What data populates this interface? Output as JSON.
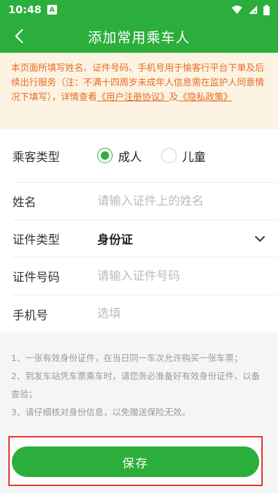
{
  "status_bar": {
    "time": "10:48",
    "notif_glyph": "A"
  },
  "header": {
    "title": "添加常用乘车人"
  },
  "notice": {
    "text": "本页面所填写姓名、证件号码、手机号用于愉客行平台下单及后续出行服务（注：不满十四周岁未成年人信息需在监护人同意情况下填写），详情查看",
    "link1": "《用户注册协议》",
    "between": "及",
    "link2": "《隐私政策》"
  },
  "form": {
    "passenger_type": {
      "label": "乘客类型",
      "options": [
        "成人",
        "儿童"
      ],
      "selected": "成人"
    },
    "name": {
      "label": "姓名",
      "placeholder": "请输入证件上的姓名"
    },
    "id_type": {
      "label": "证件类型",
      "value": "身份证"
    },
    "id_number": {
      "label": "证件号码",
      "placeholder": "请输入证件号码"
    },
    "phone": {
      "label": "手机号",
      "placeholder": "选填"
    }
  },
  "tips": [
    "1、一张有效身份证件，在当日同一车次允许购买一张车票；",
    "2、到发车站凭车票乘车时，请您务必准备好有效身份证件，以备查验；",
    "3、请仔细核对身份信息，以免赠送保险无效。"
  ],
  "save_label": "保存",
  "colors": {
    "primary": "#2cae3c",
    "notice_text": "#e76b25",
    "notice_bg": "#fdf3e2",
    "highlight": "#e0322e"
  }
}
